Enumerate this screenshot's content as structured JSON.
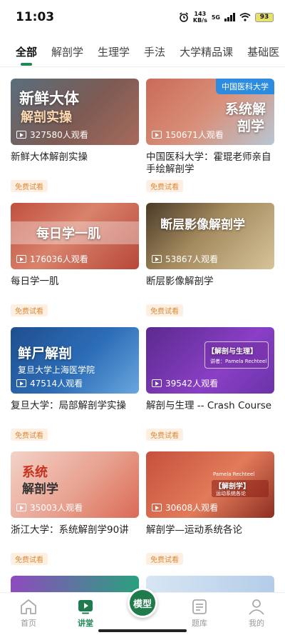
{
  "status_bar": {
    "time": "11:03",
    "speed_value": "143",
    "speed_unit": "KB/s",
    "network": "5G",
    "battery": "93"
  },
  "tabs": [
    {
      "label": "全部",
      "active": true
    },
    {
      "label": "解剖学"
    },
    {
      "label": "生理学"
    },
    {
      "label": "手法"
    },
    {
      "label": "大学精品课"
    },
    {
      "label": "基础医"
    }
  ],
  "courses": [
    {
      "thumb_title_1": "新鲜大体",
      "thumb_title_2": "解剖实操",
      "views": "327580人观看",
      "title": "新鲜大体解剖实操",
      "badge": "免费试看"
    },
    {
      "corner_tag": "中国医科大学",
      "thumb_title_1": "系统解",
      "thumb_title_2": "剖学",
      "views": "150671人观看",
      "title": "中国医科大学：霍琨老师亲自手绘解剖学",
      "badge": "免费试看"
    },
    {
      "thumb_title_1": "每日学一肌",
      "views": "176036人观看",
      "title": "每日学一肌",
      "badge": "免费试看"
    },
    {
      "thumb_title_1": "断层影像解剖学",
      "views": "53867人观看",
      "title": "断层影像解剖学",
      "badge": "免费试看"
    },
    {
      "thumb_title_1": "鲜尸解剖",
      "thumb_sub": "复旦大学上海医学院",
      "views": "47514人观看",
      "title": "复旦大学：局部解剖学实操",
      "badge": "免费试看"
    },
    {
      "thumb_title_1": "【解剖与生理】",
      "thumb_sub": "讲者：Pamela Rechteel",
      "views": "39542人观看",
      "title": "解剖与生理 -- Crash Course",
      "badge": "免费试看"
    },
    {
      "thumb_title_1": "系统",
      "thumb_title_2": "解剖学",
      "views": "35003人观看",
      "title": "浙江大学：系统解剖学90讲",
      "badge": "免费试看"
    },
    {
      "thumb_title_1": "【解剖学】",
      "thumb_sub": "运动系统各论",
      "thumb_sub2": "Pamela Rechteel",
      "views": "30608人观看",
      "title": "解剖学—运动系统各论",
      "badge": "免费试看"
    }
  ],
  "nav": [
    {
      "label": "首页",
      "icon": "home-icon"
    },
    {
      "label": "讲堂",
      "icon": "lecture-icon",
      "active": true
    },
    {
      "label": "模型",
      "icon": "model-icon"
    },
    {
      "label": "题库",
      "icon": "question-bank-icon"
    },
    {
      "label": "我的",
      "icon": "profile-icon"
    }
  ],
  "colors": {
    "accent": "#1f8a55",
    "badge_text": "#d98b3a",
    "badge_bg": "#fdf0e2"
  }
}
